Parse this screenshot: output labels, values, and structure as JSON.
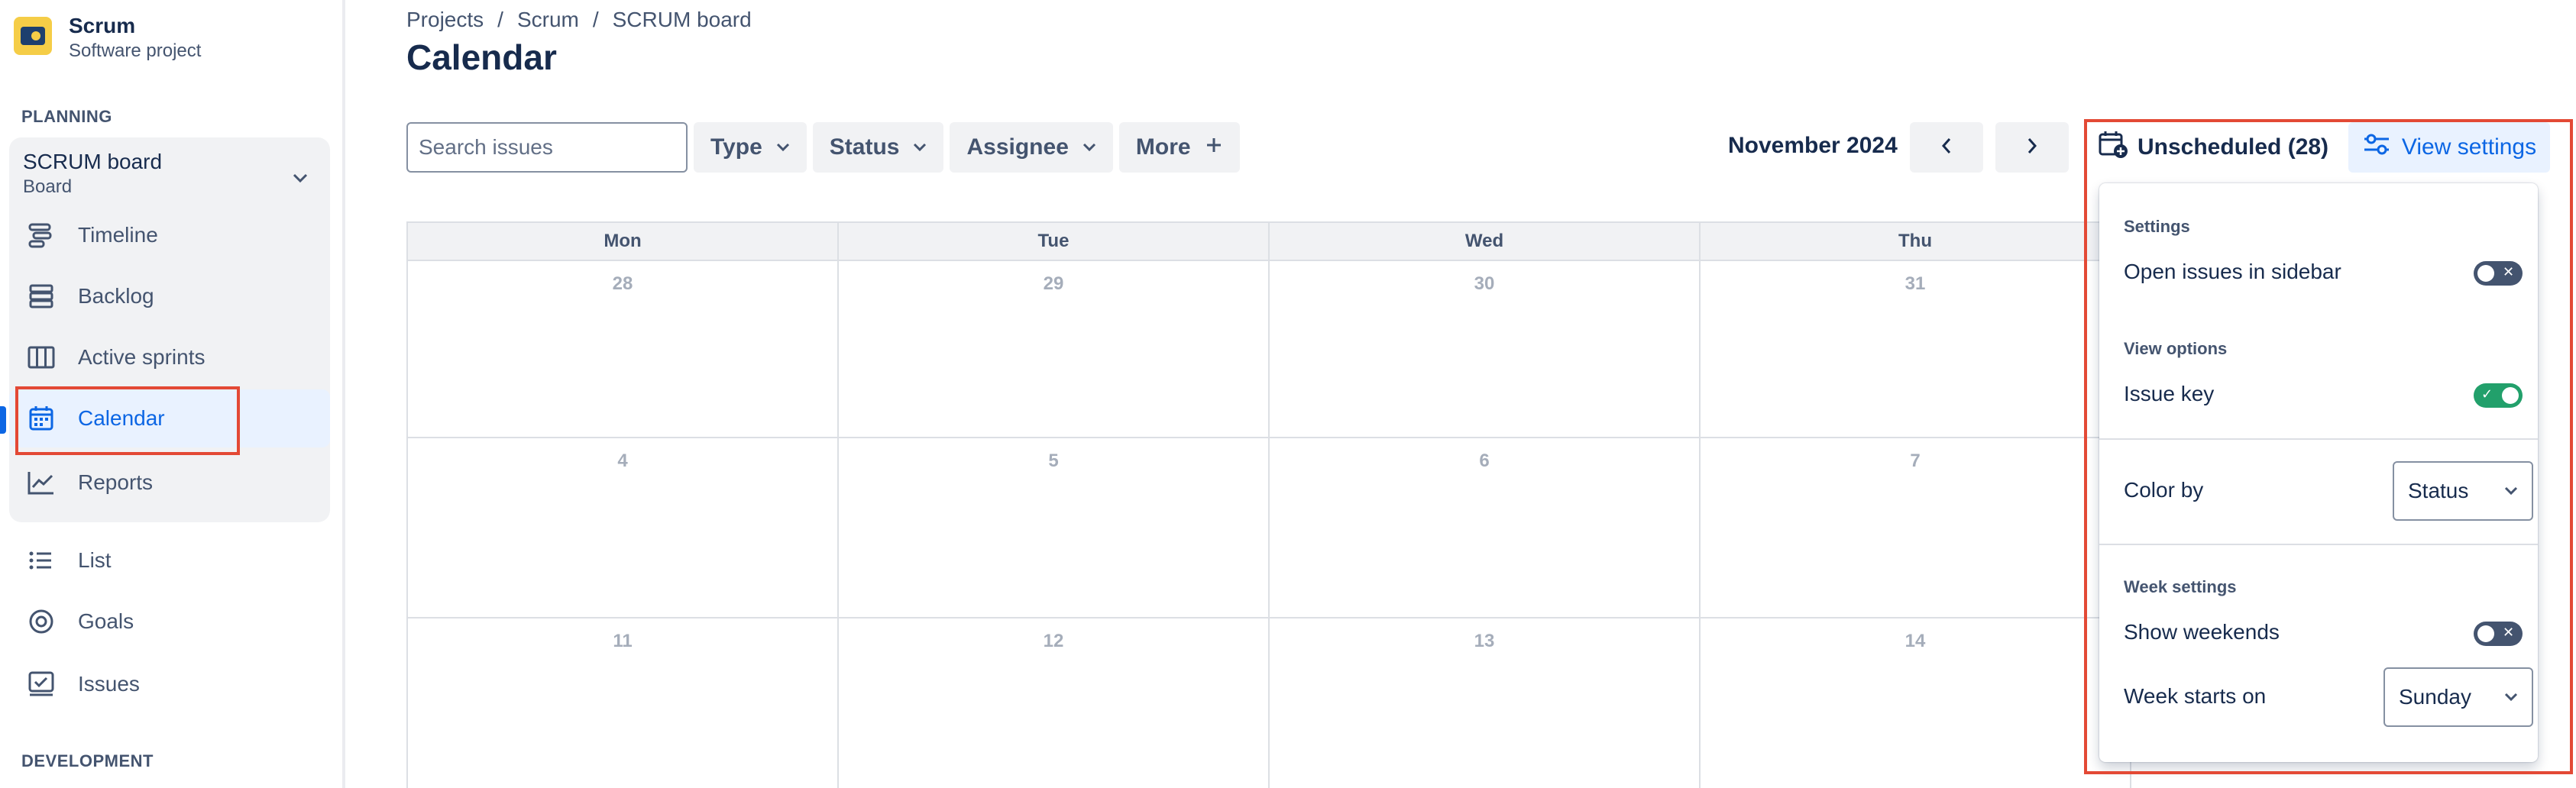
{
  "project": {
    "name": "Scrum",
    "type": "Software project"
  },
  "sidebar": {
    "planning_label": "PLANNING",
    "board": {
      "title": "SCRUM board",
      "subtitle": "Board"
    },
    "items": [
      {
        "label": "Timeline",
        "icon": "timeline-icon"
      },
      {
        "label": "Backlog",
        "icon": "backlog-icon"
      },
      {
        "label": "Active sprints",
        "icon": "board-columns-icon"
      },
      {
        "label": "Calendar",
        "icon": "calendar-icon",
        "active": true
      },
      {
        "label": "Reports",
        "icon": "chart-line-icon"
      },
      {
        "label": "List",
        "icon": "list-icon"
      },
      {
        "label": "Goals",
        "icon": "goal-icon"
      },
      {
        "label": "Issues",
        "icon": "issues-icon"
      }
    ],
    "development_label": "DEVELOPMENT"
  },
  "breadcrumb": [
    "Projects",
    "Scrum",
    "SCRUM board"
  ],
  "breadcrumb_sep": "/",
  "page_title": "Calendar",
  "toolbar": {
    "search_placeholder": "Search issues",
    "filters": [
      "Type",
      "Status",
      "Assignee"
    ],
    "more_label": "More",
    "month": "November 2024",
    "unscheduled_label": "Unscheduled (28)",
    "view_settings_label": "View settings"
  },
  "calendar": {
    "days": [
      "Mon",
      "Tue",
      "Wed",
      "Thu"
    ],
    "weeks": [
      [
        "28",
        "29",
        "30",
        "31"
      ],
      [
        "4",
        "5",
        "6",
        "7"
      ],
      [
        "11",
        "12",
        "13",
        "14"
      ]
    ]
  },
  "settings_panel": {
    "settings_heading": "Settings",
    "open_in_sidebar_label": "Open issues in sidebar",
    "open_in_sidebar": false,
    "view_options_heading": "View options",
    "issue_key_label": "Issue key",
    "issue_key": true,
    "color_by_label": "Color by",
    "color_by_value": "Status",
    "week_settings_heading": "Week settings",
    "show_weekends_label": "Show weekends",
    "show_weekends": false,
    "week_starts_label": "Week starts on",
    "week_starts_value": "Sunday"
  },
  "colors": {
    "accent": "#0c66e4",
    "highlight": "#e34935",
    "toggle_on": "#22a06b",
    "toggle_off": "#44546f"
  }
}
